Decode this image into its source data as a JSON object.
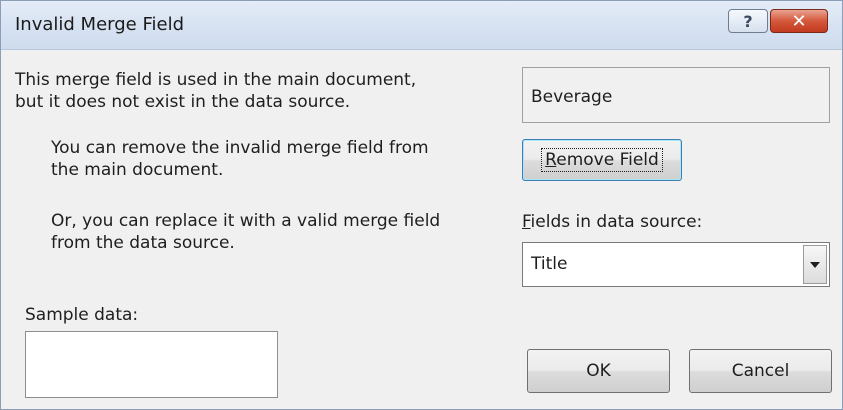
{
  "window": {
    "title": "Invalid Merge Field",
    "help_glyph": "?",
    "close_glyph": "✕",
    "icons": [
      "help-icon",
      "close-icon"
    ]
  },
  "message": {
    "line1": "This merge field is used in the main document,",
    "line2": "but it does not exist in the data source."
  },
  "field_name": "Beverage",
  "remove": {
    "line1": "You can remove the invalid merge field from",
    "line2": "the main document.",
    "button_mnemonic": "R",
    "button_rest": "emove Field"
  },
  "replace": {
    "line1": "Or, you can replace it with a valid merge field",
    "line2": "from the data source."
  },
  "fields_label": {
    "mnemonic": "F",
    "rest": "ields in data source:"
  },
  "fields_select": {
    "selected": "Title",
    "icon": "chevron-down-icon"
  },
  "sample": {
    "label": "Sample data:",
    "value": ""
  },
  "buttons": {
    "ok": "OK",
    "cancel": "Cancel"
  },
  "colors": {
    "titlebar": "#d6e2f2",
    "close_button": "#c8452a",
    "focus_border": "#3c7fb1"
  }
}
